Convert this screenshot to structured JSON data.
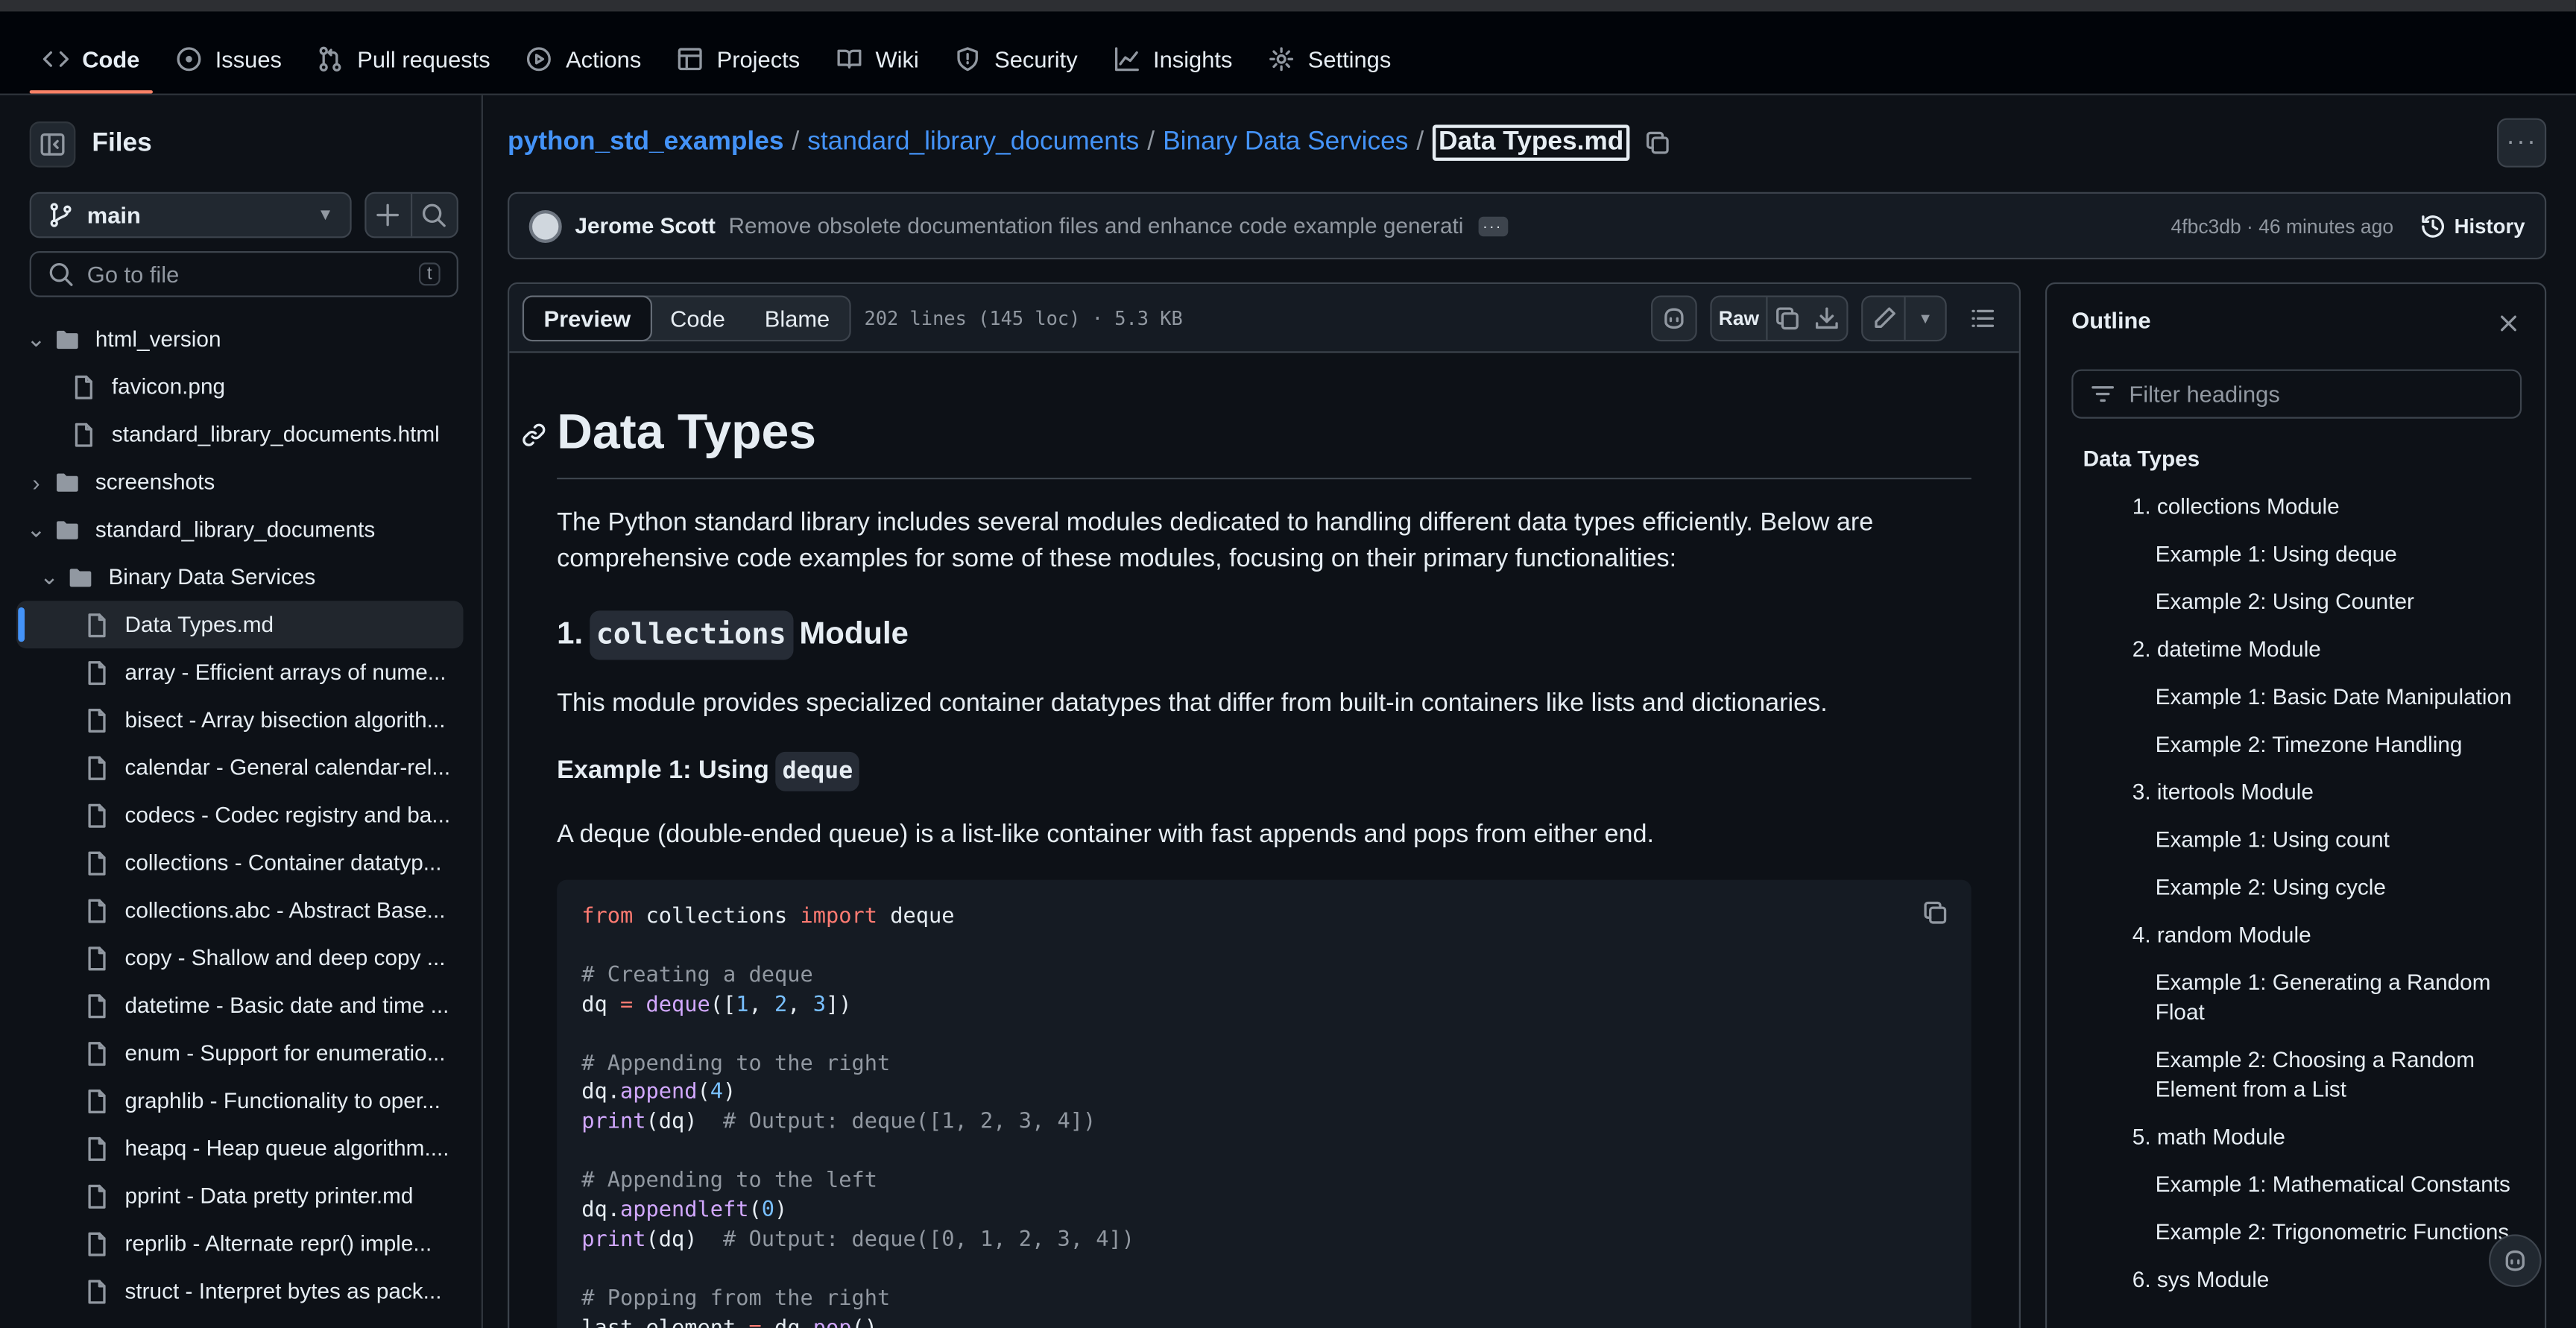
{
  "nav": {
    "tabs": [
      {
        "label": "Code",
        "icon": "code-icon"
      },
      {
        "label": "Issues",
        "icon": "issue-icon"
      },
      {
        "label": "Pull requests",
        "icon": "pull-request-icon"
      },
      {
        "label": "Actions",
        "icon": "play-icon"
      },
      {
        "label": "Projects",
        "icon": "table-icon"
      },
      {
        "label": "Wiki",
        "icon": "book-icon"
      },
      {
        "label": "Security",
        "icon": "shield-icon"
      },
      {
        "label": "Insights",
        "icon": "graph-icon"
      },
      {
        "label": "Settings",
        "icon": "gear-icon"
      }
    ],
    "active": "Code"
  },
  "sidebar": {
    "title": "Files",
    "branch": "main",
    "goto_placeholder": "Go to file",
    "goto_shortcut": "t",
    "tree": [
      {
        "label": "html_version",
        "type": "folder",
        "expanded": true
      },
      {
        "label": "favicon.png",
        "type": "file"
      },
      {
        "label": "standard_library_documents.html",
        "type": "file"
      },
      {
        "label": "screenshots",
        "type": "folder",
        "expanded": false
      },
      {
        "label": "standard_library_documents",
        "type": "folder",
        "expanded": true
      },
      {
        "label": "Binary Data Services",
        "type": "folder",
        "expanded": true
      },
      {
        "label": "Data Types.md",
        "type": "file",
        "selected": true
      },
      {
        "label": "array - Efficient arrays of nume...",
        "type": "file"
      },
      {
        "label": "bisect - Array bisection algorith...",
        "type": "file"
      },
      {
        "label": "calendar - General calendar-rel...",
        "type": "file"
      },
      {
        "label": "codecs - Codec registry and ba...",
        "type": "file"
      },
      {
        "label": "collections - Container datatyp...",
        "type": "file"
      },
      {
        "label": "collections.abc - Abstract Base...",
        "type": "file"
      },
      {
        "label": "copy - Shallow and deep copy ...",
        "type": "file"
      },
      {
        "label": "datetime - Basic date and time ...",
        "type": "file"
      },
      {
        "label": "enum - Support for enumeratio...",
        "type": "file"
      },
      {
        "label": "graphlib - Functionality to oper...",
        "type": "file"
      },
      {
        "label": "heapq - Heap queue algorithm....",
        "type": "file"
      },
      {
        "label": "pprint - Data pretty printer.md",
        "type": "file"
      },
      {
        "label": "reprlib - Alternate repr() imple...",
        "type": "file"
      },
      {
        "label": "struct - Interpret bytes as pack...",
        "type": "file"
      }
    ]
  },
  "breadcrumb": {
    "repo": "python_std_examples",
    "parts": [
      "standard_library_documents",
      "Binary Data Services"
    ],
    "current": "Data Types.md"
  },
  "commit": {
    "author": "Jerome Scott",
    "message": "Remove obsolete documentation files and enhance code example generati...",
    "sha": "4fbc3db",
    "time": "46 minutes ago",
    "history_label": "History"
  },
  "file": {
    "views": [
      "Preview",
      "Code",
      "Blame"
    ],
    "active_view": "Preview",
    "stats": "202 lines (145 loc) · 5.3 KB",
    "raw_label": "Raw"
  },
  "markdown": {
    "h1": "Data Types",
    "intro": "The Python standard library includes several modules dedicated to handling different data types efficiently. Below are comprehensive code examples for some of these modules, focusing on their primary functionalities:",
    "h2_prefix": "1.",
    "h2_code": "collections",
    "h2_suffix": "Module",
    "h2_desc": "This module provides specialized container datatypes that differ from built-in containers like lists and dictionaries.",
    "h3_prefix": "Example 1: Using",
    "h3_code": "deque",
    "h3_desc": "A deque (double-ended queue) is a list-like container with fast appends and pops from either end."
  },
  "outline": {
    "title": "Outline",
    "filter_placeholder": "Filter headings",
    "items": [
      {
        "label": "Data Types",
        "level": 1
      },
      {
        "label": "1. collections Module",
        "level": 2
      },
      {
        "label": "Example 1: Using deque",
        "level": 3
      },
      {
        "label": "Example 2: Using Counter",
        "level": 3
      },
      {
        "label": "2. datetime Module",
        "level": 2
      },
      {
        "label": "Example 1: Basic Date Manipulation",
        "level": 3
      },
      {
        "label": "Example 2: Timezone Handling",
        "level": 3
      },
      {
        "label": "3. itertools Module",
        "level": 2
      },
      {
        "label": "Example 1: Using count",
        "level": 3
      },
      {
        "label": "Example 2: Using cycle",
        "level": 3
      },
      {
        "label": "4. random Module",
        "level": 2
      },
      {
        "label": "Example 1: Generating a Random Float",
        "level": 3
      },
      {
        "label": "Example 2: Choosing a Random Element from a List",
        "level": 3
      },
      {
        "label": "5. math Module",
        "level": 2
      },
      {
        "label": "Example 1: Mathematical Constants",
        "level": 3
      },
      {
        "label": "Example 2: Trigonometric Functions",
        "level": 3
      },
      {
        "label": "6. sys Module",
        "level": 2
      }
    ]
  },
  "colors": {
    "accent": "#4493f8",
    "active_tab_underline": "#f78166",
    "background": "#0d1117",
    "border": "#3d444d"
  }
}
